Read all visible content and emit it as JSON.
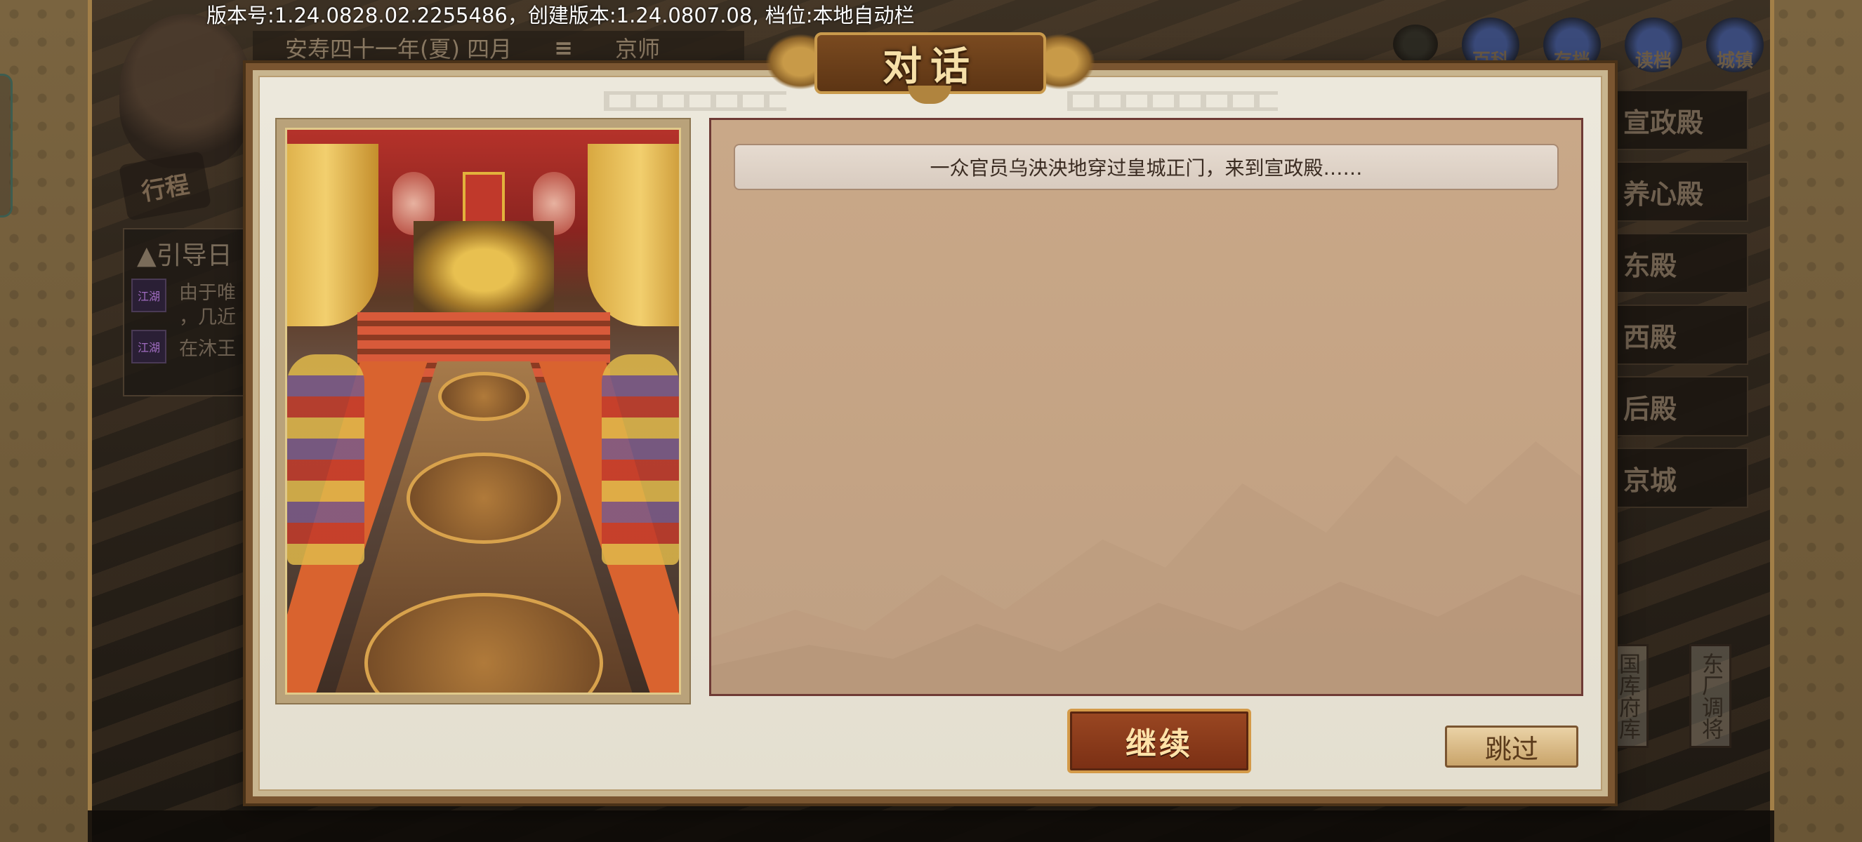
{
  "status_bar": {
    "version_text": "版本号:1.24.0828.02.2255486，创建版本:1.24.0807.08, 档位:本地自动栏"
  },
  "hud": {
    "date": "安寿四十一年(夏) 四月",
    "location": "京师",
    "itinerary_label": "行程",
    "guide_title": "引导日",
    "guide_lines": [
      "由于唯",
      "，几近",
      "在沐王"
    ],
    "guide_icon_label": "江湖",
    "top_icons": [
      "",
      "百科",
      "存档",
      "读档",
      "城镇"
    ],
    "right_nav": [
      "宣政殿",
      "养心殿",
      "东殿",
      "西殿",
      "后殿",
      "京城"
    ],
    "treasury_label": "国库府库",
    "east_factory_label": "东厂调将"
  },
  "dialog": {
    "title": "对话",
    "line": "一众官员乌泱泱地穿过皇城正门，来到宣政殿……",
    "continue_label": "继续",
    "skip_label": "跳过"
  },
  "colors": {
    "frame_brown": "#7a5530",
    "panel_tan": "#c9a888",
    "button_red": "#8a3a1a",
    "title_gold": "#f6e0a8"
  }
}
